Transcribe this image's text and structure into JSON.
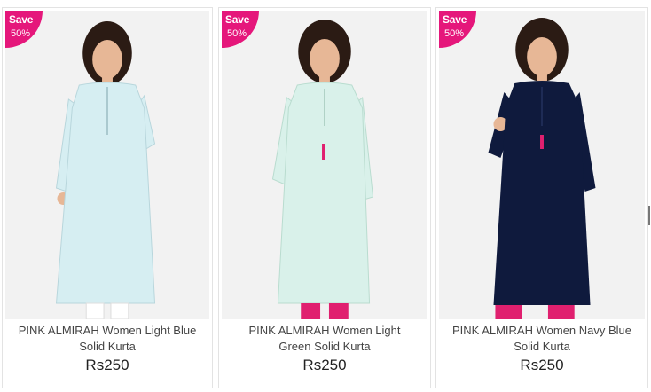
{
  "products": [
    {
      "badge_label": "Save",
      "badge_value": "50%",
      "name": "PINK ALMIRAH Women Light Blue Solid Kurta",
      "price": "Rs250",
      "kurta_color": "#d6eef2",
      "legging_color": "#ffffff"
    },
    {
      "badge_label": "Save",
      "badge_value": "50%",
      "name": "PINK ALMIRAH Women Light Green Solid Kurta",
      "price": "Rs250",
      "kurta_color": "#d9f1ea",
      "legging_color": "#e0206f"
    },
    {
      "badge_label": "Save",
      "badge_value": "50%",
      "name": "PINK ALMIRAH Women Navy Blue Solid Kurta",
      "price": "Rs250",
      "kurta_color": "#0f1a3d",
      "legging_color": "#e0206f"
    }
  ],
  "colors": {
    "badge": "#e5177b",
    "card_border": "#e3e3e3"
  }
}
